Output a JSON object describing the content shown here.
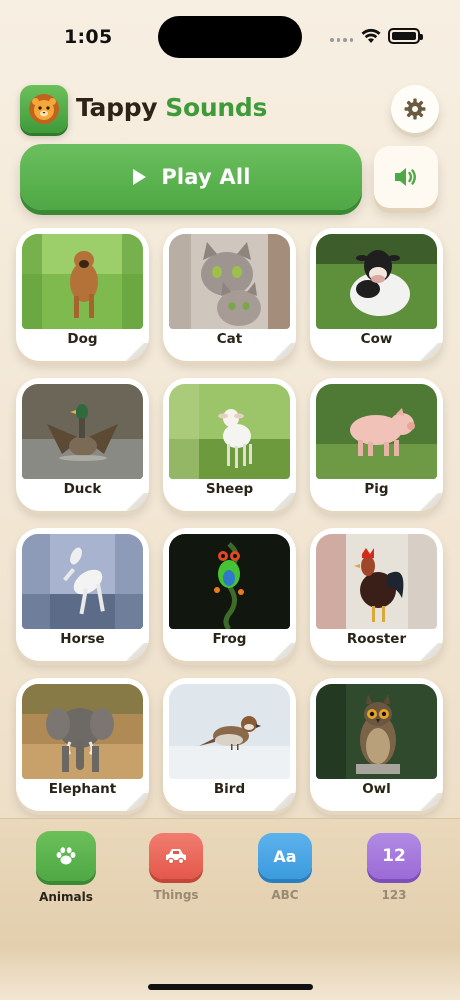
{
  "status_bar": {
    "time": "1:05"
  },
  "header": {
    "title_part1": "Tappy",
    "title_part2": "Sounds",
    "logo_icon": "lion-icon",
    "settings_icon": "gear-icon"
  },
  "controls": {
    "play_all_label": "Play All",
    "play_icon": "play-icon",
    "sound_icon": "speaker-icon"
  },
  "animals": [
    {
      "label": "Dog"
    },
    {
      "label": "Cat"
    },
    {
      "label": "Cow"
    },
    {
      "label": "Duck"
    },
    {
      "label": "Sheep"
    },
    {
      "label": "Pig"
    },
    {
      "label": "Horse"
    },
    {
      "label": "Frog"
    },
    {
      "label": "Rooster"
    },
    {
      "label": "Elephant"
    },
    {
      "label": "Bird"
    },
    {
      "label": "Owl"
    }
  ],
  "bottom_nav": {
    "active": "Animals",
    "items": [
      {
        "label": "Animals",
        "icon": "paw-icon",
        "color": "#4ea844"
      },
      {
        "label": "Things",
        "icon": "car-icon",
        "color": "#ec6b5e"
      },
      {
        "label": "ABC",
        "icon": "text-aa-icon",
        "icon_text": "Aa",
        "color": "#3b9bde"
      },
      {
        "label": "123",
        "icon": "numbers-icon",
        "icon_text": "12",
        "color": "#9c6ad6"
      }
    ]
  },
  "colors": {
    "brand_green": "#4ea844",
    "title_dark": "#2d2418",
    "background": "#f1e5d1"
  }
}
